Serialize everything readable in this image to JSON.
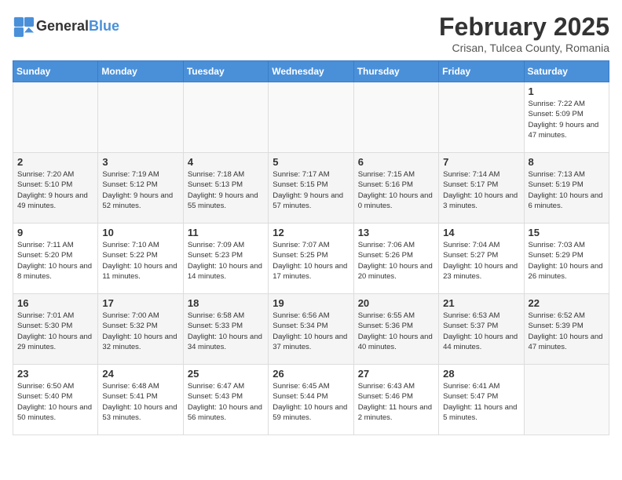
{
  "header": {
    "logo_line1": "General",
    "logo_line2": "Blue",
    "month": "February 2025",
    "location": "Crisan, Tulcea County, Romania"
  },
  "weekdays": [
    "Sunday",
    "Monday",
    "Tuesday",
    "Wednesday",
    "Thursday",
    "Friday",
    "Saturday"
  ],
  "weeks": [
    [
      {
        "day": "",
        "info": ""
      },
      {
        "day": "",
        "info": ""
      },
      {
        "day": "",
        "info": ""
      },
      {
        "day": "",
        "info": ""
      },
      {
        "day": "",
        "info": ""
      },
      {
        "day": "",
        "info": ""
      },
      {
        "day": "1",
        "info": "Sunrise: 7:22 AM\nSunset: 5:09 PM\nDaylight: 9 hours and 47 minutes."
      }
    ],
    [
      {
        "day": "2",
        "info": "Sunrise: 7:20 AM\nSunset: 5:10 PM\nDaylight: 9 hours and 49 minutes."
      },
      {
        "day": "3",
        "info": "Sunrise: 7:19 AM\nSunset: 5:12 PM\nDaylight: 9 hours and 52 minutes."
      },
      {
        "day": "4",
        "info": "Sunrise: 7:18 AM\nSunset: 5:13 PM\nDaylight: 9 hours and 55 minutes."
      },
      {
        "day": "5",
        "info": "Sunrise: 7:17 AM\nSunset: 5:15 PM\nDaylight: 9 hours and 57 minutes."
      },
      {
        "day": "6",
        "info": "Sunrise: 7:15 AM\nSunset: 5:16 PM\nDaylight: 10 hours and 0 minutes."
      },
      {
        "day": "7",
        "info": "Sunrise: 7:14 AM\nSunset: 5:17 PM\nDaylight: 10 hours and 3 minutes."
      },
      {
        "day": "8",
        "info": "Sunrise: 7:13 AM\nSunset: 5:19 PM\nDaylight: 10 hours and 6 minutes."
      }
    ],
    [
      {
        "day": "9",
        "info": "Sunrise: 7:11 AM\nSunset: 5:20 PM\nDaylight: 10 hours and 8 minutes."
      },
      {
        "day": "10",
        "info": "Sunrise: 7:10 AM\nSunset: 5:22 PM\nDaylight: 10 hours and 11 minutes."
      },
      {
        "day": "11",
        "info": "Sunrise: 7:09 AM\nSunset: 5:23 PM\nDaylight: 10 hours and 14 minutes."
      },
      {
        "day": "12",
        "info": "Sunrise: 7:07 AM\nSunset: 5:25 PM\nDaylight: 10 hours and 17 minutes."
      },
      {
        "day": "13",
        "info": "Sunrise: 7:06 AM\nSunset: 5:26 PM\nDaylight: 10 hours and 20 minutes."
      },
      {
        "day": "14",
        "info": "Sunrise: 7:04 AM\nSunset: 5:27 PM\nDaylight: 10 hours and 23 minutes."
      },
      {
        "day": "15",
        "info": "Sunrise: 7:03 AM\nSunset: 5:29 PM\nDaylight: 10 hours and 26 minutes."
      }
    ],
    [
      {
        "day": "16",
        "info": "Sunrise: 7:01 AM\nSunset: 5:30 PM\nDaylight: 10 hours and 29 minutes."
      },
      {
        "day": "17",
        "info": "Sunrise: 7:00 AM\nSunset: 5:32 PM\nDaylight: 10 hours and 32 minutes."
      },
      {
        "day": "18",
        "info": "Sunrise: 6:58 AM\nSunset: 5:33 PM\nDaylight: 10 hours and 34 minutes."
      },
      {
        "day": "19",
        "info": "Sunrise: 6:56 AM\nSunset: 5:34 PM\nDaylight: 10 hours and 37 minutes."
      },
      {
        "day": "20",
        "info": "Sunrise: 6:55 AM\nSunset: 5:36 PM\nDaylight: 10 hours and 40 minutes."
      },
      {
        "day": "21",
        "info": "Sunrise: 6:53 AM\nSunset: 5:37 PM\nDaylight: 10 hours and 44 minutes."
      },
      {
        "day": "22",
        "info": "Sunrise: 6:52 AM\nSunset: 5:39 PM\nDaylight: 10 hours and 47 minutes."
      }
    ],
    [
      {
        "day": "23",
        "info": "Sunrise: 6:50 AM\nSunset: 5:40 PM\nDaylight: 10 hours and 50 minutes."
      },
      {
        "day": "24",
        "info": "Sunrise: 6:48 AM\nSunset: 5:41 PM\nDaylight: 10 hours and 53 minutes."
      },
      {
        "day": "25",
        "info": "Sunrise: 6:47 AM\nSunset: 5:43 PM\nDaylight: 10 hours and 56 minutes."
      },
      {
        "day": "26",
        "info": "Sunrise: 6:45 AM\nSunset: 5:44 PM\nDaylight: 10 hours and 59 minutes."
      },
      {
        "day": "27",
        "info": "Sunrise: 6:43 AM\nSunset: 5:46 PM\nDaylight: 11 hours and 2 minutes."
      },
      {
        "day": "28",
        "info": "Sunrise: 6:41 AM\nSunset: 5:47 PM\nDaylight: 11 hours and 5 minutes."
      },
      {
        "day": "",
        "info": ""
      }
    ]
  ]
}
